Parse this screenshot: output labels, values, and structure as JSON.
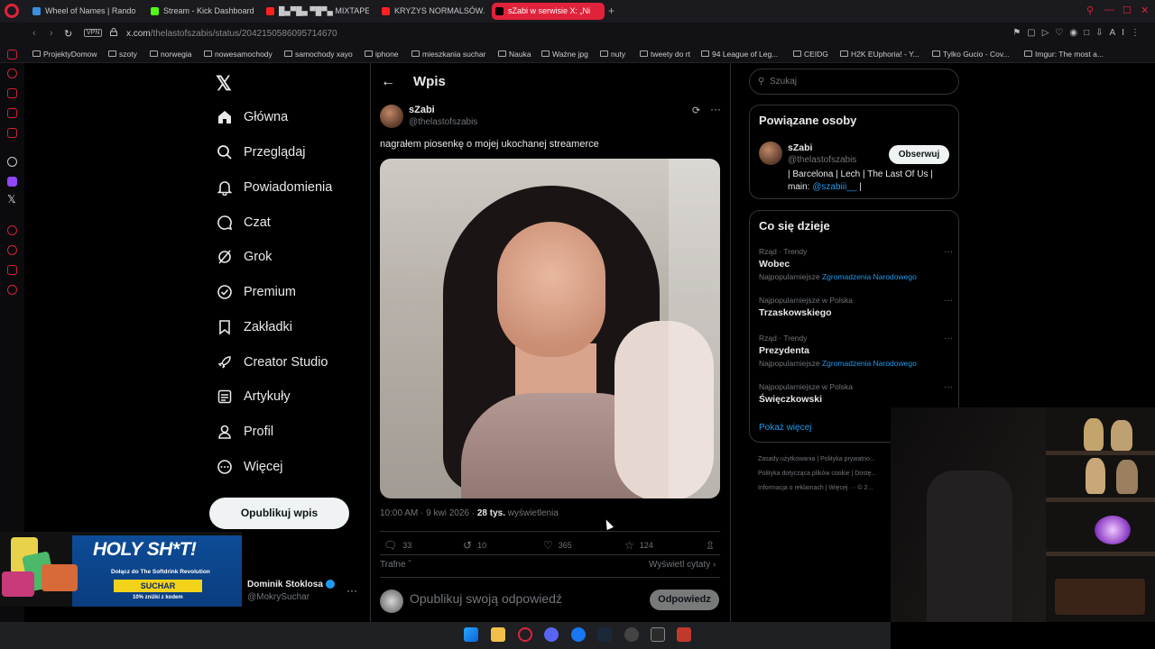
{
  "browser": {
    "tabs": [
      {
        "label": "Wheel of Names | Random",
        "color": "#3a8fe0"
      },
      {
        "label": "Stream - Kick Dashboard",
        "color": "#53fc18"
      },
      {
        "label": "█▄▀█▄ ▀█▀▄ MIXTAPE",
        "color": "#ff2020"
      },
      {
        "label": "KRYZYS NORMALSÓW. P...",
        "color": "#ff2020"
      },
      {
        "label": "sZabi w serwisie X: „Ni",
        "color": "#000000"
      }
    ],
    "address": {
      "vpn": "VPN",
      "domain": "x.com",
      "path": "/thelastofszabis/status/2042150586095714670"
    },
    "bookmarks": [
      "ProjektyDomow",
      "szoty",
      "norwegia",
      "nowesamochody",
      "samochody xayo",
      "iphone",
      "mieszkania suchar",
      "Nauka",
      "Ważne jpg",
      "nuty",
      "tweety do rt",
      "94 League of Leg...",
      "CEIDG",
      "H2K EUphoria! - Y...",
      "Tylko Gucio - Cov...",
      "Imgur: The most a..."
    ],
    "ai_label": "AI"
  },
  "x": {
    "nav": [
      "Główna",
      "Przeglądaj",
      "Powiadomienia",
      "Czat",
      "Grok",
      "Premium",
      "Zakładki",
      "Creator Studio",
      "Artykuły",
      "Profil",
      "Więcej"
    ],
    "post_button": "Opublikuj wpis",
    "column_title": "Wpis",
    "post": {
      "author_name": "sZabi",
      "author_handle": "@thelastofszabis",
      "text": "nagrałem piosenkę o mojej ukochanej streamerce",
      "time": "10:00 AM · 9 kwi 2026 · ",
      "views_count": "28 tys.",
      "views_label": " wyświetlenia",
      "replies": "33",
      "reposts": "10",
      "likes": "365",
      "bookmarks": "124",
      "sort_label": "Trafne",
      "quotes_link": "Wyświetl cytaty",
      "reply_placeholder": "Opublikuj swoją odpowiedź",
      "reply_button": "Odpowiedz"
    },
    "search_placeholder": "Szukaj",
    "related": {
      "title": "Powiązane osoby",
      "name": "sZabi",
      "handle": "@thelastofszabis",
      "follow": "Obserwuj",
      "bio_text": "| Barcelona | Lech | The Last Of Us | main: ",
      "bio_link": "@szabiii__",
      "bio_end": " |"
    },
    "trends": {
      "title": "Co się dzieje",
      "items": [
        {
          "context": "Rząd · Trendy",
          "name": "Wobec",
          "sub_prefix": "Najpopularniejsze ",
          "sub_link": "Zgromadzenia Narodowego"
        },
        {
          "context": "Najpopularniejsze w Polska",
          "name": "Trzaskowskiego",
          "sub_prefix": "",
          "sub_link": ""
        },
        {
          "context": "Rząd · Trendy",
          "name": "Prezydenta",
          "sub_prefix": "Najpopularniejsze ",
          "sub_link": "Zgromadzenia Narodowego"
        },
        {
          "context": "Najpopularniejsze w Polska",
          "name": "Święczkowski",
          "sub_prefix": "",
          "sub_link": ""
        }
      ],
      "show_more": "Pokaż więcej"
    },
    "footer": {
      "line1": "Zasady użytkowania  |  Polityka prywatno...",
      "line2": "Polityka dotycząca plików cookie  |  Dostę...",
      "line3": "Informacja o reklamach  |  Więcej ···  © 2..."
    }
  },
  "overlay": {
    "ad": {
      "headline": "HOLY SH*T!",
      "line": "Dołącz do The Softdrink Revolution",
      "brand": "SUCHAR",
      "discount": "10% zniżki z kodem"
    },
    "tweeter": {
      "name": "Dominik Stoklosa",
      "handle": "@MokrySuchar"
    }
  }
}
